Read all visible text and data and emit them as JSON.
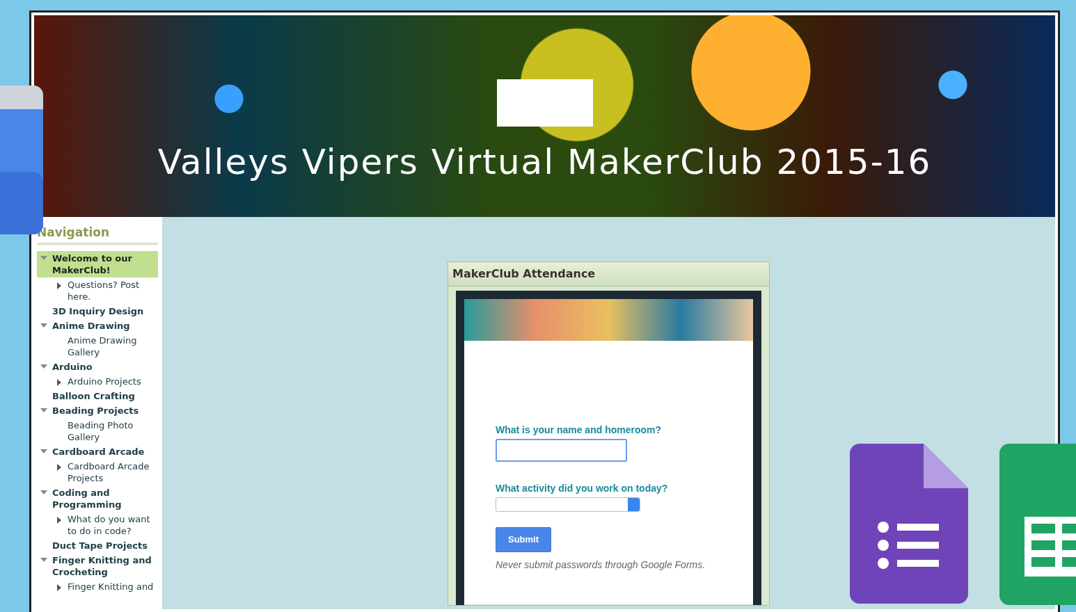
{
  "site": {
    "title": "Valleys Vipers Virtual MakerClub 2015-16"
  },
  "sidebar": {
    "title": "Navigation",
    "items": [
      {
        "label": "Welcome to our MakerClub!",
        "kind": "branch",
        "expanded": true,
        "selected": true,
        "children": [
          {
            "label": "Questions? Post here.",
            "kind": "branch",
            "expanded": false,
            "selected": false
          }
        ]
      },
      {
        "label": "3D Inquiry Design",
        "kind": "leaf",
        "selected": false
      },
      {
        "label": "Anime Drawing",
        "kind": "branch",
        "expanded": true,
        "selected": false,
        "children": [
          {
            "label": "Anime Drawing Gallery",
            "kind": "leaf",
            "selected": false
          }
        ]
      },
      {
        "label": "Arduino",
        "kind": "branch",
        "expanded": true,
        "selected": false,
        "children": [
          {
            "label": "Arduino Projects",
            "kind": "branch",
            "expanded": false,
            "selected": false
          }
        ]
      },
      {
        "label": "Balloon Crafting",
        "kind": "leaf",
        "selected": false
      },
      {
        "label": "Beading Projects",
        "kind": "branch",
        "expanded": true,
        "selected": false,
        "children": [
          {
            "label": "Beading Photo Gallery",
            "kind": "leaf",
            "selected": false
          }
        ]
      },
      {
        "label": "Cardboard Arcade",
        "kind": "branch",
        "expanded": true,
        "selected": false,
        "children": [
          {
            "label": "Cardboard Arcade Projects",
            "kind": "branch",
            "expanded": false,
            "selected": false
          }
        ]
      },
      {
        "label": "Coding and Programming",
        "kind": "branch",
        "expanded": true,
        "selected": false,
        "children": [
          {
            "label": "What do you want to do in code?",
            "kind": "branch",
            "expanded": false,
            "selected": false
          }
        ]
      },
      {
        "label": "Duct Tape Projects",
        "kind": "leaf",
        "selected": false
      },
      {
        "label": "Finger Knitting and Crocheting",
        "kind": "branch",
        "expanded": true,
        "selected": false,
        "children": [
          {
            "label": "Finger Knitting and",
            "kind": "branch",
            "expanded": false,
            "selected": false
          }
        ]
      }
    ]
  },
  "gadget": {
    "title": "MakerClub Attendance",
    "questions": [
      {
        "label": "What is your name and homeroom?",
        "kind": "text"
      },
      {
        "label": "What activity did you work on today?",
        "kind": "select"
      }
    ],
    "submit": "Submit",
    "note": "Never submit passwords through Google Forms."
  }
}
